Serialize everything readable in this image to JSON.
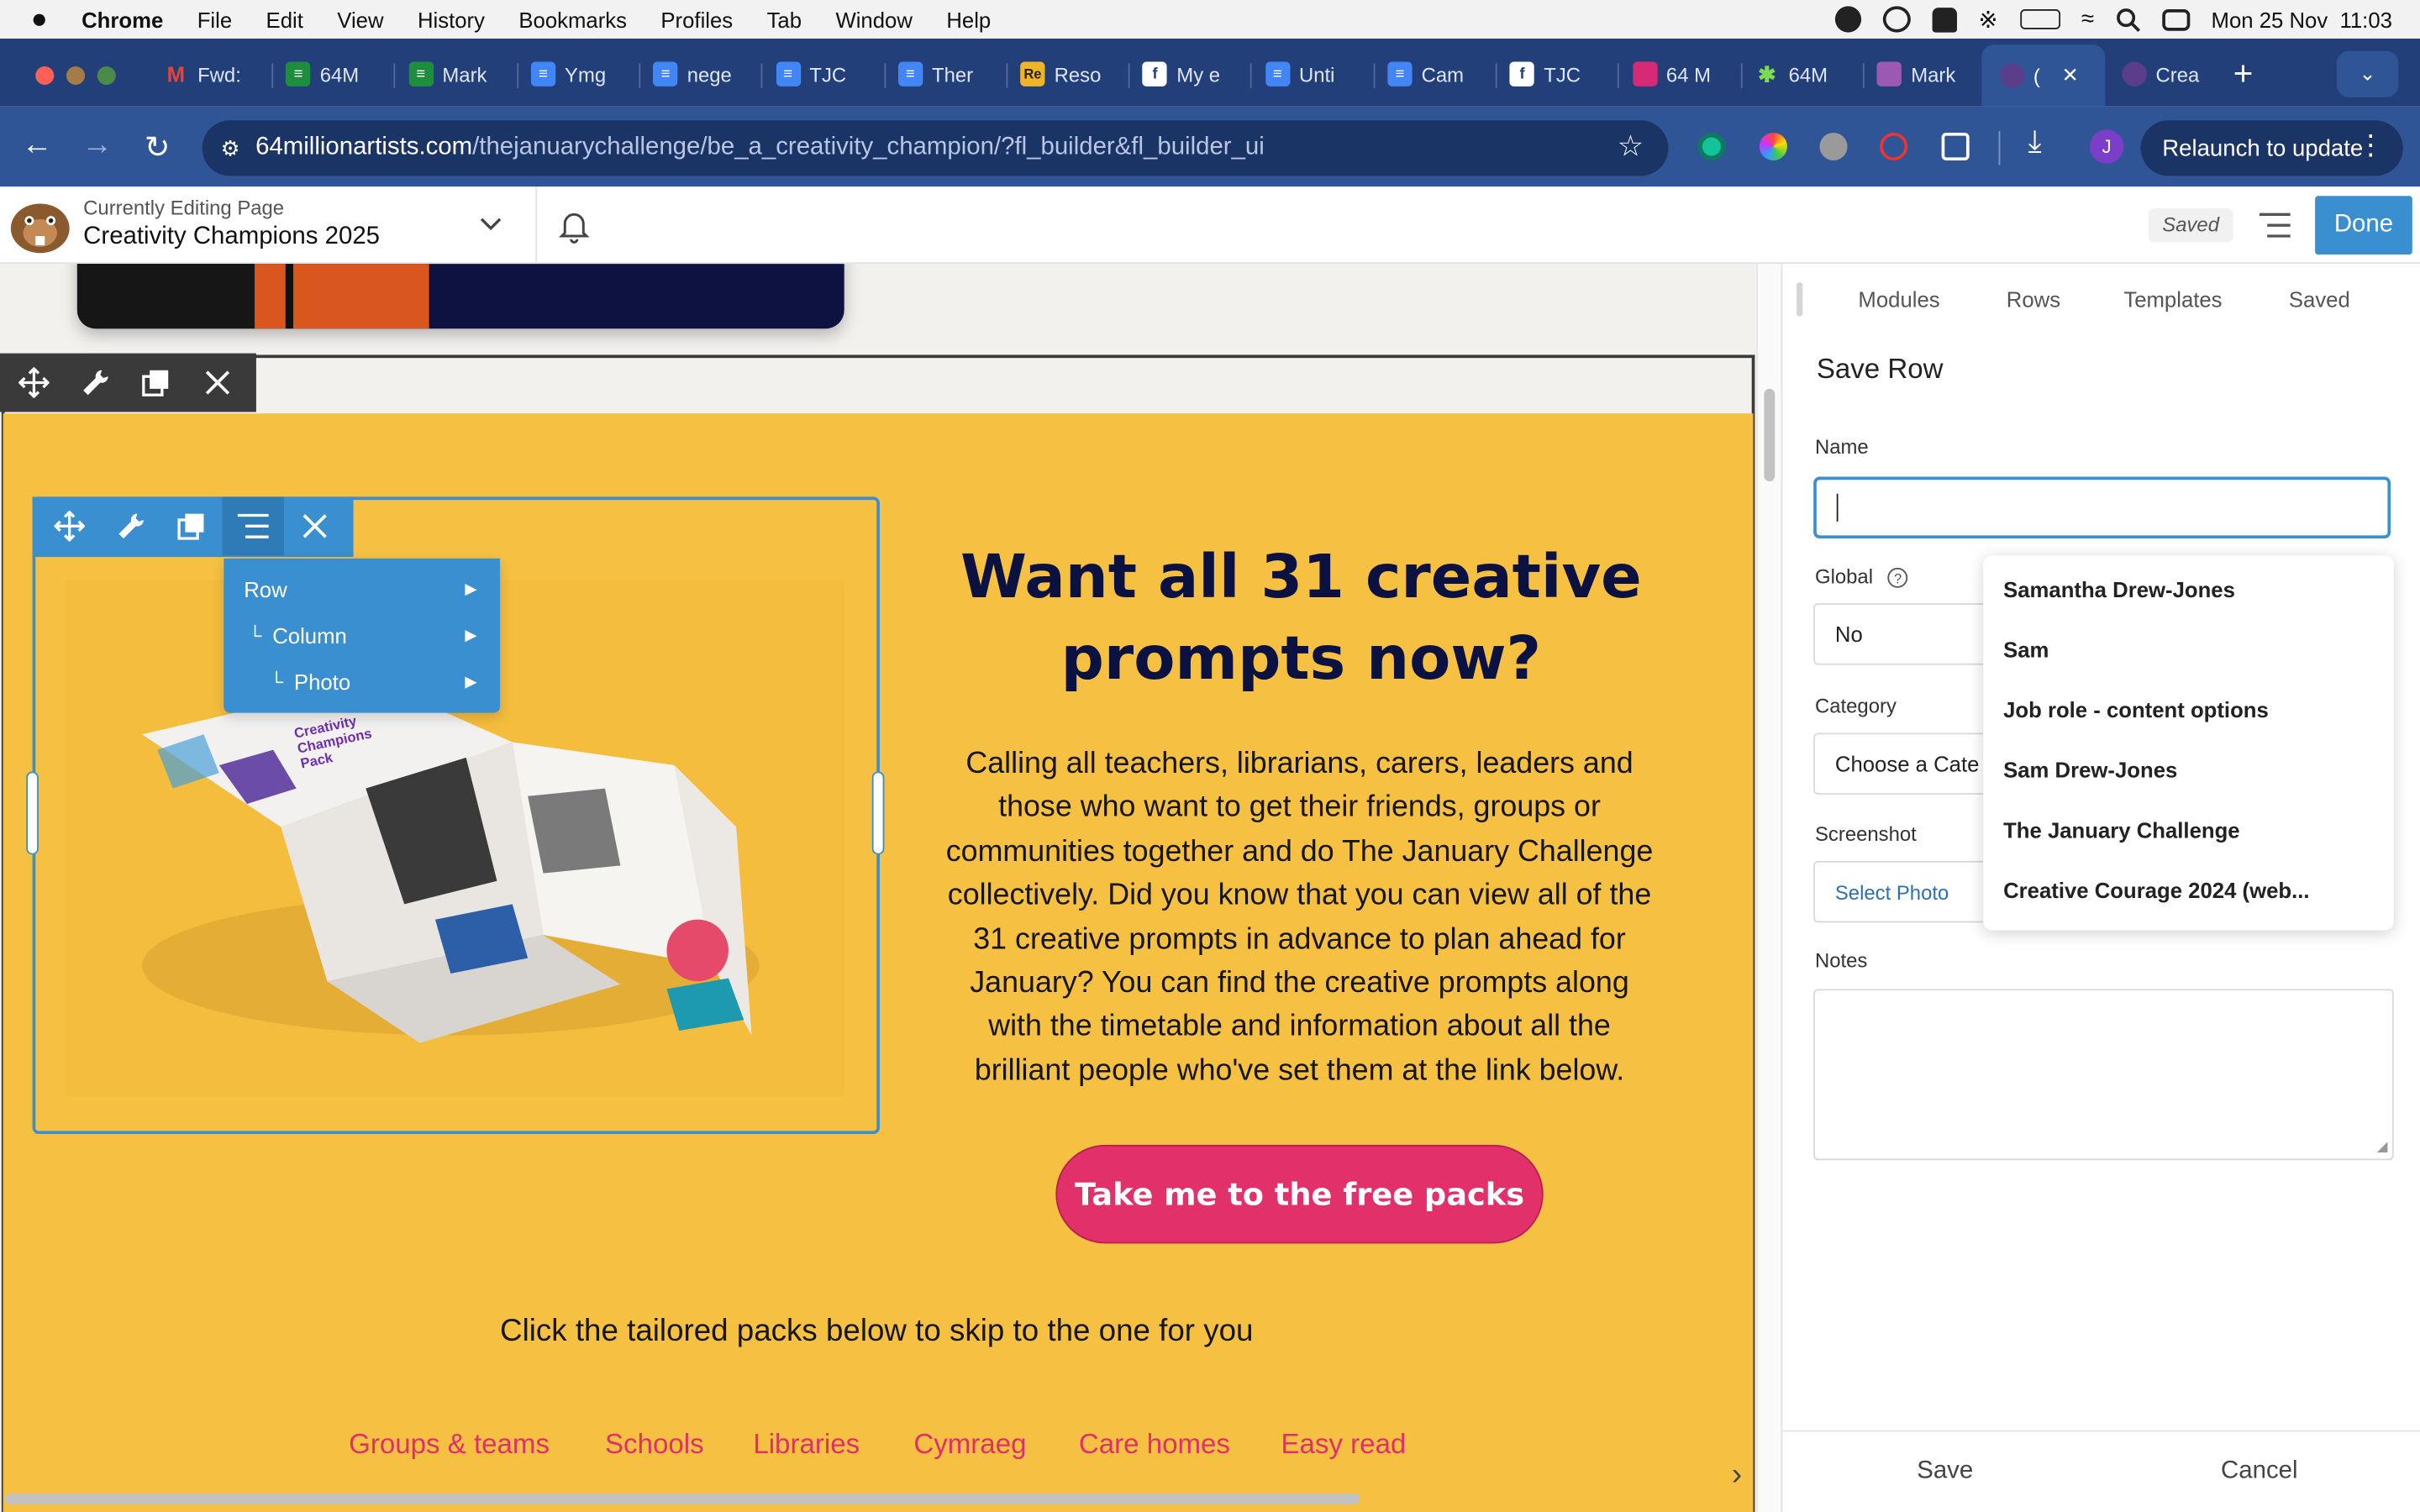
{
  "menubar": {
    "app": "Chrome",
    "items": [
      "File",
      "Edit",
      "View",
      "History",
      "Bookmarks",
      "Profiles",
      "Tab",
      "Window",
      "Help"
    ],
    "datetime": "Mon 25 Nov  11:03"
  },
  "tabs": [
    {
      "label": "Fwd:",
      "icon": "gmail-icon",
      "color": "#ea4335"
    },
    {
      "label": "64M",
      "icon": "sheets-icon",
      "color": "#1e8e3e"
    },
    {
      "label": "Mark",
      "icon": "sheets-icon",
      "color": "#1e8e3e"
    },
    {
      "label": "Ymg",
      "icon": "docs-icon",
      "color": "#4285f4"
    },
    {
      "label": "nege",
      "icon": "docs-icon",
      "color": "#4285f4"
    },
    {
      "label": "TJC",
      "icon": "docs-icon",
      "color": "#4285f4"
    },
    {
      "label": "Ther",
      "icon": "docs-icon",
      "color": "#4285f4"
    },
    {
      "label": "Reso",
      "icon": "re-icon",
      "color": "#f0b429"
    },
    {
      "label": "My e",
      "icon": "facebook-icon",
      "color": "#ffffff"
    },
    {
      "label": "Unti",
      "icon": "docs-icon",
      "color": "#4285f4"
    },
    {
      "label": "Cam",
      "icon": "docs-icon",
      "color": "#4285f4"
    },
    {
      "label": "TJC",
      "icon": "facebook-icon",
      "color": "#ffffff"
    },
    {
      "label": "64 M",
      "icon": "instagram-icon",
      "color": "#d62976"
    },
    {
      "label": "64M",
      "icon": "asterisk-icon",
      "color": "#7ed957"
    },
    {
      "label": "Mark",
      "icon": "calendar-icon",
      "color": "#9b59b6"
    },
    {
      "label": "(",
      "icon": "site-icon",
      "color": "#5a3e8c"
    },
    {
      "label": "Crea",
      "icon": "site-icon",
      "color": "#5a3e8c"
    }
  ],
  "address": {
    "host": "64millionartists.com",
    "path": "/thejanuarychallenge/be_a_creativity_champion/?fl_builder&fl_builder_ui",
    "relaunch": "Relaunch to update",
    "profile_initial": "J"
  },
  "builder": {
    "editing_label": "Currently Editing Page",
    "page_title": "Creativity Champions 2025",
    "saved_label": "Saved",
    "done_label": "Done"
  },
  "context_menu": {
    "items": [
      "Row",
      "Column",
      "Photo"
    ]
  },
  "content": {
    "heading_line1": "Want all 31 creative",
    "heading_line2": "prompts now?",
    "paragraph_lines": [
      "Calling all teachers, librarians, carers, leaders and",
      "those who want to get their friends, groups or",
      "communities together and do The January Challenge",
      "collectively. Did you know that you can view all of the",
      "31 creative prompts in advance to plan ahead for",
      "January? You can find the creative prompts along",
      "with the timetable and information about all the",
      "brilliant people who've set them at the link below."
    ],
    "cta": "Take me to the free packs",
    "subtext": "Click the tailored packs below to skip to the one for you",
    "packs": [
      "Groups & teams",
      "Schools",
      "Libraries",
      "Cymraeg",
      "Care homes",
      "Easy read"
    ],
    "brochure_title": "Creativity Champions Pack"
  },
  "panel": {
    "tabs": [
      "Modules",
      "Rows",
      "Templates",
      "Saved"
    ],
    "title": "Save Row",
    "name_label": "Name",
    "name_value": "",
    "global_label": "Global",
    "global_value": "No",
    "category_label": "Category",
    "category_value": "Choose a Cate",
    "screenshot_label": "Screenshot",
    "screenshot_button": "Select Photo",
    "notes_label": "Notes",
    "save": "Save",
    "cancel": "Cancel",
    "autocomplete": [
      "Samantha Drew-Jones",
      "Sam",
      "Job role - content options",
      "Sam Drew-Jones",
      "The January Challenge",
      "Creative Courage 2024 (web..."
    ]
  },
  "colors": {
    "tabstrip": "#223f7a",
    "navrow": "#2f5597",
    "builder_blue": "#3a8fd0",
    "page_yellow": "#f6c142",
    "heading_navy": "#0b1140",
    "cta_pink": "#e2306a"
  }
}
